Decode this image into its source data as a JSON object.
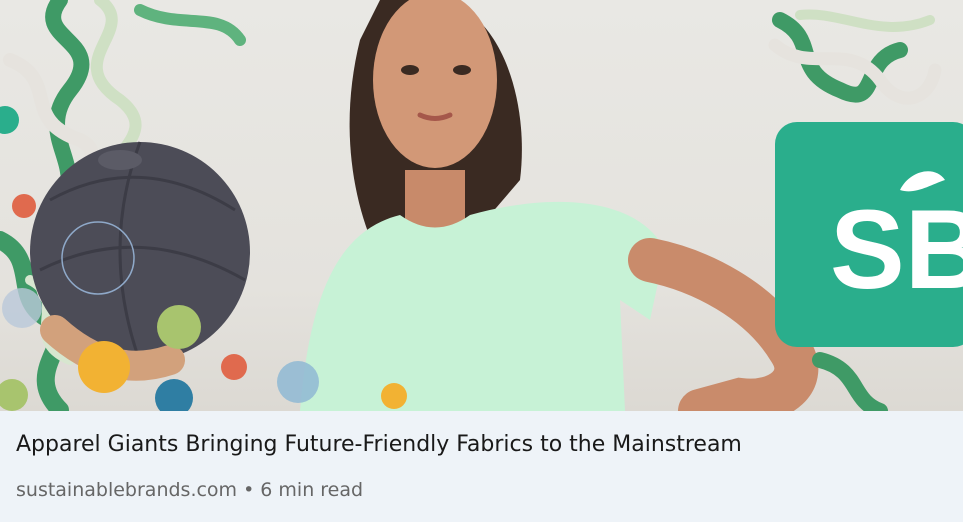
{
  "article": {
    "title": "Apparel Giants Bringing Future-Friendly Fabrics to the Mainstream",
    "source": "sustainablebrands.com",
    "separator": "•",
    "read_time": "6 min read"
  },
  "image": {
    "logo_text": "SB",
    "colors": {
      "logo_green": "#2aae8c",
      "shirt_mint": "#c7f2d6",
      "ball_gray": "#4c4c57",
      "vine_green": "#3f9a66",
      "background": "#e7e6e2"
    }
  }
}
